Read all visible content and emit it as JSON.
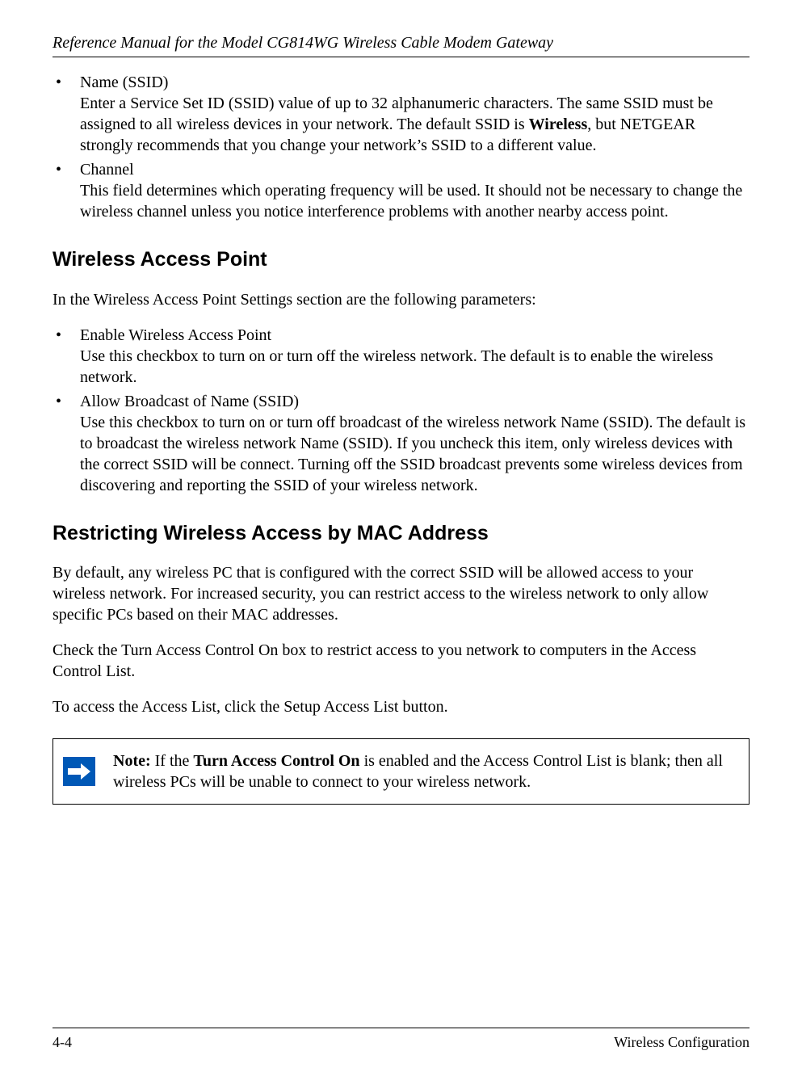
{
  "header": {
    "title": "Reference Manual for the Model CG814WG Wireless Cable Modem Gateway"
  },
  "intro_list": {
    "item1": {
      "title": "Name (SSID)",
      "body_pre": "Enter a Service Set ID (SSID) value of up to 32 alphanumeric characters. The same SSID must be assigned to all wireless devices in your network. The default SSID is ",
      "strong": "Wireless",
      "body_post": ", but NETGEAR strongly recommends that you change your network’s SSID to a different value."
    },
    "item2": {
      "title": "Channel",
      "body": "This field determines which operating frequency will be used. It should not be necessary to change the wireless channel unless you notice interference problems with another nearby access point."
    }
  },
  "section1": {
    "heading": "Wireless Access Point",
    "intro": "In the Wireless Access Point Settings section are the following parameters:",
    "item1": {
      "title": "Enable Wireless Access Point",
      "body": "Use this checkbox to turn on or turn off the wireless network. The default is to enable the wireless network."
    },
    "item2": {
      "title": "Allow Broadcast of Name (SSID)",
      "body": "Use this checkbox to turn on or turn off broadcast of the wireless network Name (SSID). The default is to broadcast the wireless network Name (SSID). If you uncheck this item, only wireless devices with the correct SSID will be connect. Turning off the SSID broadcast prevents some wireless devices from discovering and reporting the SSID of your wireless network."
    }
  },
  "section2": {
    "heading": "Restricting Wireless Access by MAC Address",
    "p1": "By default, any wireless PC that is configured with the correct SSID will be allowed access to your wireless network. For increased security, you can restrict access to the wireless network to only allow specific PCs based on their MAC addresses.",
    "p2": "Check the Turn Access Control On box to restrict access to you network to computers in the Access Control List.",
    "p3": "To access the Access List, click the Setup Access List button."
  },
  "note": {
    "label": "Note: ",
    "pre": "If the ",
    "strong": "Turn Access Control On",
    "post": " is enabled and the Access Control List is blank; then all wireless PCs will be unable to connect to your wireless network."
  },
  "footer": {
    "page": "4-4",
    "section": "Wireless Configuration"
  }
}
